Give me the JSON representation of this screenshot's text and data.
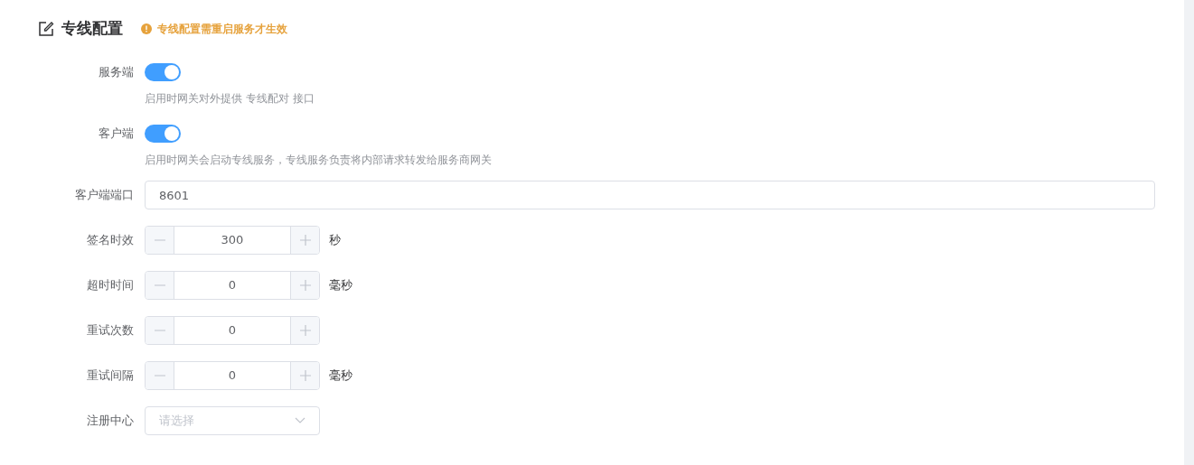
{
  "section": {
    "title": "专线配置",
    "notice": "专线配置需重启服务才生效"
  },
  "fields": [
    {
      "kind": "switch",
      "label": "服务端",
      "on": true,
      "help": "启用时网关对外提供 专线配对 接口"
    },
    {
      "kind": "switch",
      "label": "客户端",
      "on": true,
      "help": "启用时网关会启动专线服务，专线服务负责将内部请求转发给服务商网关"
    },
    {
      "kind": "input",
      "label": "客户端端口",
      "value": "8601"
    },
    {
      "kind": "number",
      "label": "签名时效",
      "value": "300",
      "unit": "秒"
    },
    {
      "kind": "number",
      "label": "超时时间",
      "value": "0",
      "unit": "毫秒"
    },
    {
      "kind": "number",
      "label": "重试次数",
      "value": "0"
    },
    {
      "kind": "number",
      "label": "重试间隔",
      "value": "0",
      "unit": "毫秒"
    },
    {
      "kind": "select",
      "label": "注册中心",
      "placeholder": "请选择"
    }
  ]
}
